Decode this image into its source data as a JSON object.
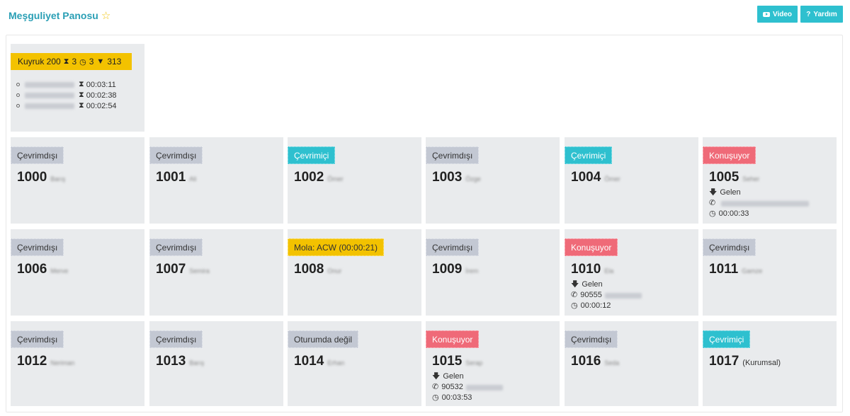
{
  "header": {
    "title": "Meşguliyet Panosu",
    "video_label": "Video",
    "help_label": "Yardım"
  },
  "queue": {
    "label": "Kuyruk 200",
    "waiting": "3",
    "active": "3",
    "total": "313",
    "calls": [
      {
        "number": "05313712182",
        "time": "00:03:11"
      },
      {
        "number": "05057965295",
        "time": "00:02:38"
      },
      {
        "number": "05352201507",
        "time": "00:02:54"
      }
    ]
  },
  "agents": [
    {
      "ext": "1000",
      "name": "Barış",
      "status": "Çevrimdışı",
      "kind": "off"
    },
    {
      "ext": "1001",
      "name": "Ali",
      "status": "Çevrimdışı",
      "kind": "off"
    },
    {
      "ext": "1002",
      "name": "Ömer",
      "status": "Çevrimiçi",
      "kind": "on"
    },
    {
      "ext": "1003",
      "name": "Özge",
      "status": "Çevrimdışı",
      "kind": "off"
    },
    {
      "ext": "1004",
      "name": "Ömer",
      "status": "Çevrimiçi",
      "kind": "on"
    },
    {
      "ext": "1005",
      "name": "Seher",
      "status": "Konuşuyor",
      "kind": "talk",
      "direction": "Gelen",
      "phone_prefix": "",
      "duration": "00:00:33"
    },
    {
      "ext": "1006",
      "name": "Merve",
      "status": "Çevrimdışı",
      "kind": "off"
    },
    {
      "ext": "1007",
      "name": "Semira",
      "status": "Çevrimdışı",
      "kind": "off"
    },
    {
      "ext": "1008",
      "name": "Onur",
      "status": "Mola: ACW (00:00:21)",
      "kind": "break"
    },
    {
      "ext": "1009",
      "name": "İrem",
      "status": "Çevrimdışı",
      "kind": "off"
    },
    {
      "ext": "1010",
      "name": "Ela",
      "status": "Konuşuyor",
      "kind": "talk",
      "direction": "Gelen",
      "phone_prefix": "90555",
      "duration": "00:00:12"
    },
    {
      "ext": "1011",
      "name": "Gamze",
      "status": "Çevrimdışı",
      "kind": "off"
    },
    {
      "ext": "1012",
      "name": "Neriman",
      "status": "Çevrimdışı",
      "kind": "off"
    },
    {
      "ext": "1013",
      "name": "Barış",
      "status": "Çevrimdışı",
      "kind": "off"
    },
    {
      "ext": "1014",
      "name": "Erhan",
      "status": "Oturumda değil",
      "kind": "out"
    },
    {
      "ext": "1015",
      "name": "Serap",
      "status": "Konuşuyor",
      "kind": "talk",
      "direction": "Gelen",
      "phone_prefix": "90532",
      "duration": "00:03:53"
    },
    {
      "ext": "1016",
      "name": "Seda",
      "status": "Çevrimdışı",
      "kind": "off"
    },
    {
      "ext": "1017",
      "name": "(Kurumsal)",
      "status": "Çevrimiçi",
      "kind": "on",
      "name_visible": true
    }
  ],
  "colors": {
    "accent": "#2ec0cf",
    "offline": "#c3c8d3",
    "talking": "#ef6a78",
    "break": "#f3c200",
    "card_bg": "#e9ebed"
  }
}
